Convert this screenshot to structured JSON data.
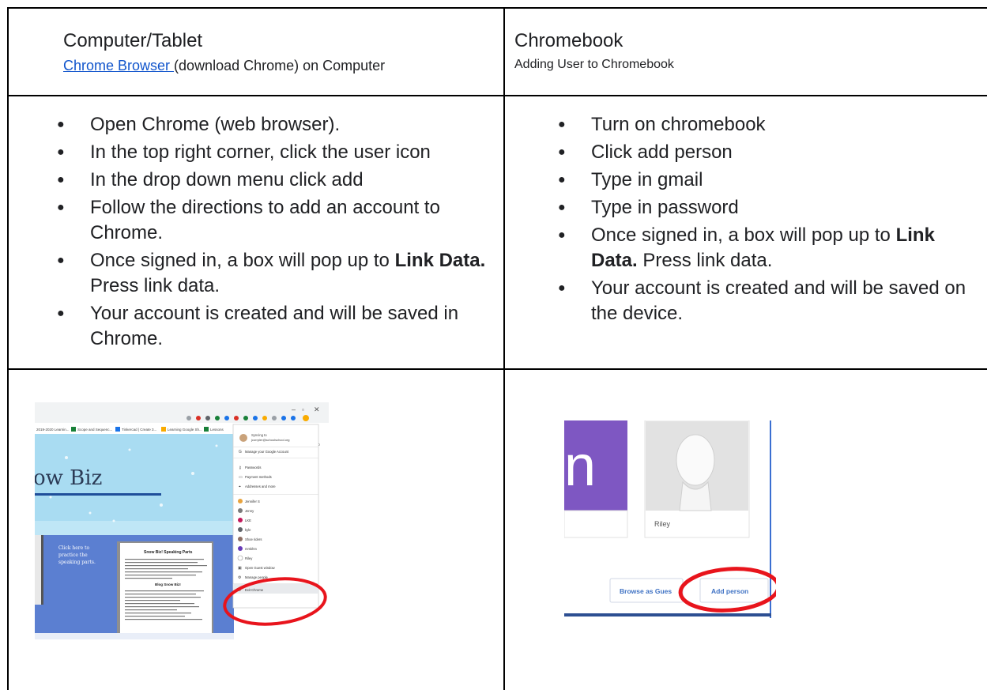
{
  "left_header": {
    "title": "Computer/Tablet",
    "link_text": "Chrome Browser ",
    "link_suffix": "(download Chrome) on Computer"
  },
  "right_header": {
    "title": "Chromebook",
    "subtitle": "Adding User to Chromebook"
  },
  "left_steps": [
    {
      "text": "Open Chrome (web browser)."
    },
    {
      "text": "In the top right corner, click the user icon"
    },
    {
      "text": "In the drop down menu click add"
    },
    {
      "text": "Follow the directions to add an account to Chrome."
    },
    {
      "pre": "Once signed in, a box will pop up to ",
      "bold": "Link Data.",
      "post": "  Press link data."
    },
    {
      "text": "Your account is created and will be saved in Chrome."
    }
  ],
  "right_steps": [
    {
      "text": "Turn on chromebook"
    },
    {
      "text": "Click add person"
    },
    {
      "text": "Type in gmail"
    },
    {
      "text": "Type in password"
    },
    {
      "pre": "Once signed in, a box will pop up to ",
      "bold": "Link Data.",
      "post": "  Press link data."
    },
    {
      "text": "Your account is created and will be saved on the device."
    }
  ],
  "chrome_shot": {
    "banner_text": "ow Biz",
    "side_text": "Click here to practice the speaking parts.",
    "doc_title": "Snow Biz! Speaking Parts",
    "doc_sub": "Blog Snow Biz!",
    "bookmarks": [
      "2019-2020 Learnin...",
      "Scope and Sequenc...",
      "Tinkercad | Create 3...",
      "Learning Google Sh...",
      "Lessons"
    ],
    "menu_header": "Syncing to",
    "menu_email": "jcorrpler@schoolschool.org",
    "menu_items": [
      "Manage your Google Account",
      "Passwords",
      "Payment methods",
      "Addresses and more",
      "Jennifer S",
      "Jenny",
      "LKE",
      "kyle",
      "Shoe riders",
      "mrskhm",
      "Riley",
      "Open Guest window",
      "Manage people",
      "Exit Chrome"
    ],
    "colors": {
      "banner": "#a9dcf2",
      "lower": "#5b7fd1",
      "menu_bg": "#ffffff",
      "circle": "#e8141c"
    }
  },
  "chromebook_shot": {
    "tile_letter": "n",
    "profile_name": "Riley",
    "guest_button": "Browse as Guest",
    "add_button": "Add person",
    "colors": {
      "tile": "#7e57c2",
      "button_text": "#3f72c4",
      "circle": "#e8141c"
    }
  }
}
